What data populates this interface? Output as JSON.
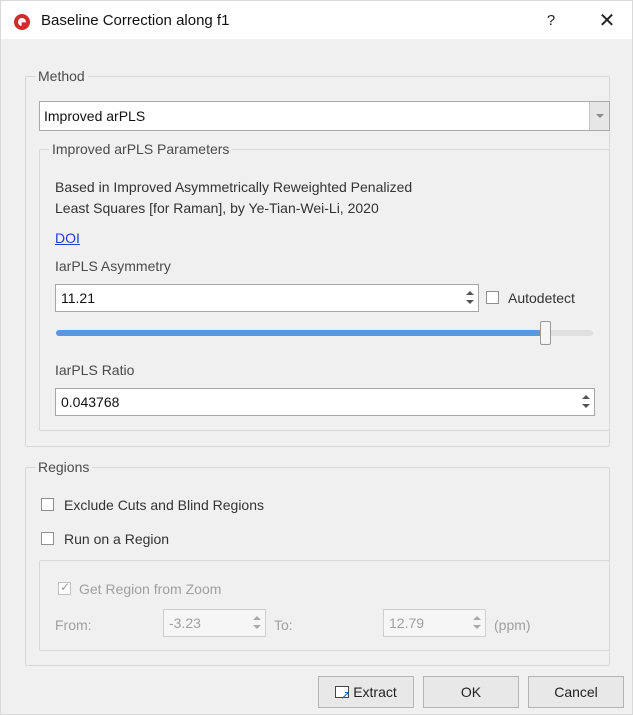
{
  "window": {
    "title": "Baseline Correction along f1",
    "help": "?",
    "close": "✕"
  },
  "method": {
    "title": "Method",
    "selected": "Improved arPLS",
    "params": {
      "title": "Improved arPLS Parameters",
      "desc1": "Based in Improved Asymmetrically Reweighted Penalized",
      "desc2": "Least Squares [for Raman], by Ye-Tian-Wei-Li, 2020",
      "link": "DOI",
      "asym_label": "IarPLS Asymmetry",
      "asym_value": "11.21",
      "autodetect": "Autodetect",
      "slider_fraction": 0.92,
      "ratio_label": "IarPLS Ratio",
      "ratio_value": "0.043768"
    }
  },
  "regions": {
    "title": "Regions",
    "exclude": "Exclude Cuts and Blind Regions",
    "run": "Run on a Region",
    "get_zoom": "Get Region from Zoom",
    "from_label": "From:",
    "from_value": "-3.23",
    "to_label": "To:",
    "to_value": "12.79",
    "unit": "(ppm)"
  },
  "buttons": {
    "extract": "Extract",
    "ok": "OK",
    "cancel": "Cancel"
  },
  "colors": {
    "accent": "#5a97dc",
    "link": "#1f3fcc",
    "app_icon": "#d12b2b"
  }
}
